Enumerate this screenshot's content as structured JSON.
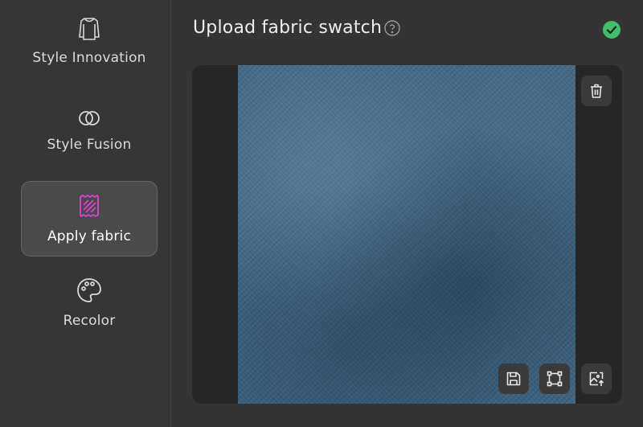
{
  "sidebar": {
    "items": [
      {
        "label": "Style Innovation",
        "icon": "garment-icon",
        "active": false
      },
      {
        "label": "Style Fusion",
        "icon": "overlapping-circles-icon",
        "active": false
      },
      {
        "label": "Apply fabric",
        "icon": "fabric-swatch-icon",
        "active": true
      },
      {
        "label": "Recolor",
        "icon": "palette-icon",
        "active": false
      }
    ]
  },
  "header": {
    "title": "Upload fabric swatch",
    "help_icon": "question-circle-icon",
    "status_icon": "check-circle-icon"
  },
  "swatch": {
    "actions": [
      "delete-icon",
      "save-icon",
      "crop-icon",
      "image-upload-icon"
    ]
  },
  "colors": {
    "accent_active_icon": "#e040d8",
    "status_success": "#3fbf6a",
    "fabric": "#3f6583"
  }
}
